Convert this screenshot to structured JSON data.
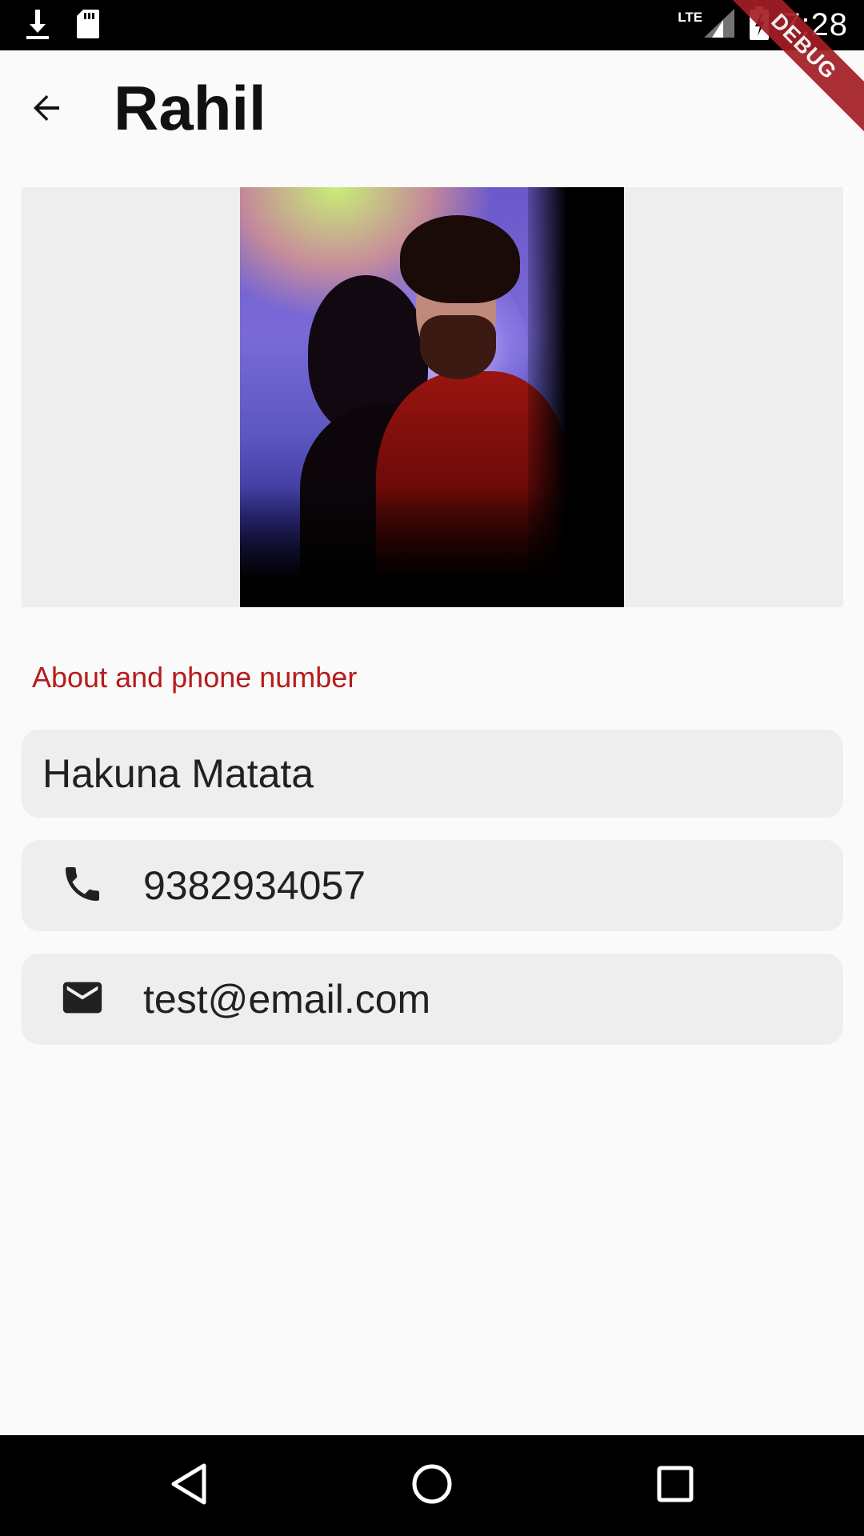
{
  "status_bar": {
    "time": "7:28",
    "network": "LTE",
    "left_icons": [
      "download-icon",
      "sd-card-icon"
    ],
    "right_icons": [
      "signal-icon",
      "battery-charging-icon"
    ]
  },
  "debug_banner": "DEBUG",
  "app_bar": {
    "title": "Rahil",
    "back_icon": "arrow-back-icon"
  },
  "profile": {
    "photo_alt": "profile-photo"
  },
  "section": {
    "label": "About and phone number"
  },
  "fields": {
    "about": "Hakuna Matata",
    "phone": "9382934057",
    "email": "test@email.com"
  },
  "colors": {
    "accent": "#b71c1c",
    "field_bg": "#eeeeee",
    "background": "#fafafa"
  },
  "nav_bar": {
    "buttons": [
      "back-triangle-icon",
      "home-circle-icon",
      "recents-square-icon"
    ]
  }
}
